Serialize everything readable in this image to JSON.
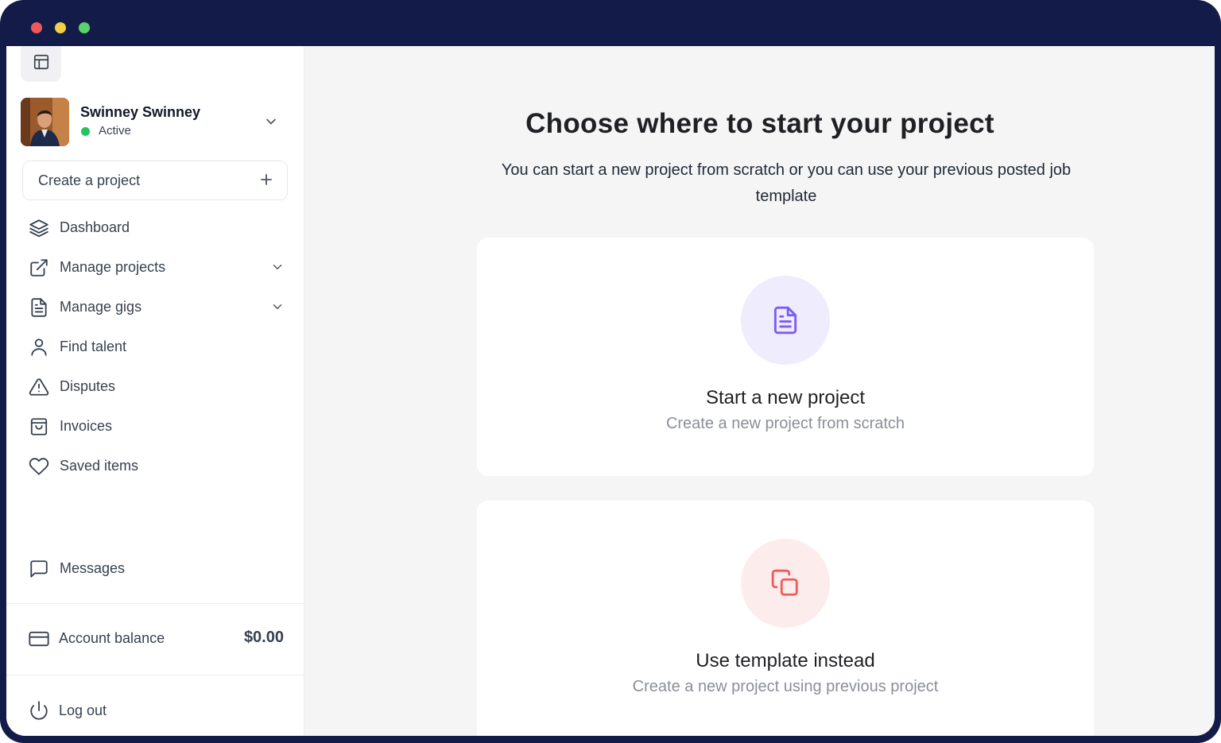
{
  "window": {
    "traffic_lights": [
      "#ee5a5a",
      "#f3cf46",
      "#5bd26b"
    ]
  },
  "sidebar": {
    "layout_icon": "layout-icon",
    "profile": {
      "name": "Swinney Swinney",
      "status": "Active",
      "status_color": "#22c55e"
    },
    "create_project": {
      "label": "Create a project",
      "icon": "plus-icon"
    },
    "nav": [
      {
        "label": "Dashboard",
        "icon": "layers-icon",
        "has_submenu": false
      },
      {
        "label": "Manage projects",
        "icon": "external-link-icon",
        "has_submenu": true
      },
      {
        "label": "Manage gigs",
        "icon": "document-icon",
        "has_submenu": true
      },
      {
        "label": "Find talent",
        "icon": "user-icon",
        "has_submenu": false
      },
      {
        "label": "Disputes",
        "icon": "alert-triangle-icon",
        "has_submenu": false
      },
      {
        "label": "Invoices",
        "icon": "shopping-bag-icon",
        "has_submenu": false
      },
      {
        "label": "Saved items",
        "icon": "heart-icon",
        "has_submenu": false
      }
    ],
    "messages": {
      "label": "Messages",
      "icon": "message-square-icon"
    },
    "account_balance": {
      "label": "Account balance",
      "amount": "$0.00",
      "icon": "credit-card-icon"
    },
    "logout": {
      "label": "Log out",
      "icon": "power-icon"
    }
  },
  "main": {
    "title": "Choose where to start your project",
    "subtitle": "You can start a new project from scratch or you can use your previous posted job template",
    "options": [
      {
        "title": "Start a new project",
        "description": "Create a new project from scratch",
        "icon": "file-text-icon",
        "accent": "#7c5cf5",
        "bg": "#efecfd"
      },
      {
        "title": "Use template instead",
        "description": "Create a new project using previous project",
        "icon": "copy-icon",
        "accent": "#ef5b5b",
        "bg": "#fdecec"
      }
    ]
  }
}
